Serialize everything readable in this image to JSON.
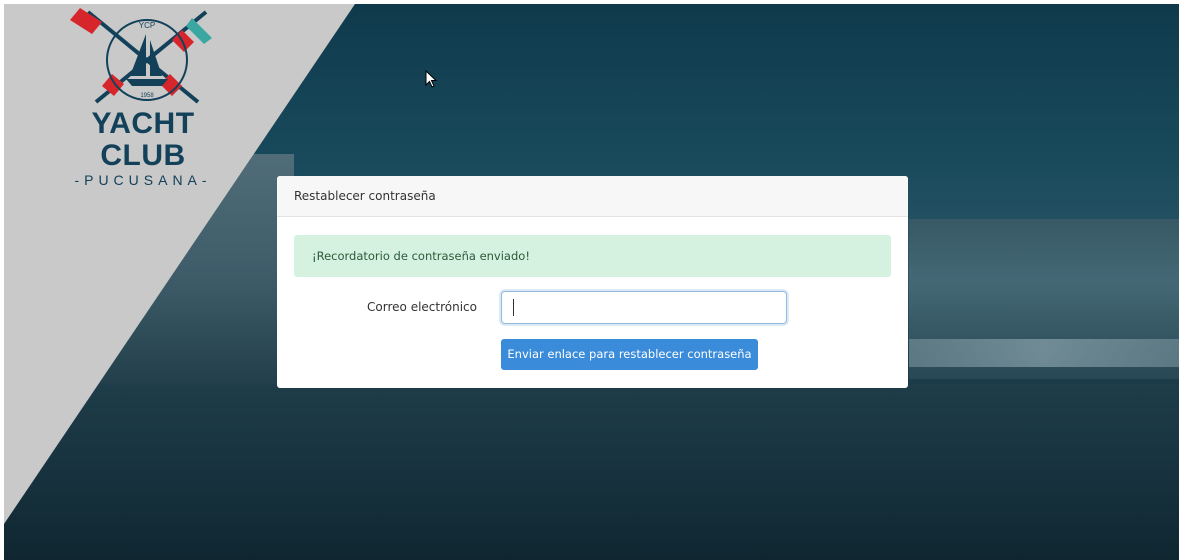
{
  "brand": {
    "badge_text": "YCP",
    "year": "1958",
    "title": "YACHT CLUB",
    "subtitle": "-PUCUSANA-"
  },
  "card": {
    "header_title": "Restablecer contraseña",
    "alert_text": "¡Recordatorio de contraseña enviado!",
    "email_label": "Correo electrónico",
    "email_value": "",
    "email_placeholder": "",
    "submit_label": "Enviar enlace para restablecer contraseña"
  },
  "colors": {
    "brand_navy": "#13415a",
    "flag_red": "#d6262c",
    "accent_teal": "#3aa7a3",
    "button_blue": "#3a8bd9",
    "alert_green_bg": "#d5f1e0"
  }
}
